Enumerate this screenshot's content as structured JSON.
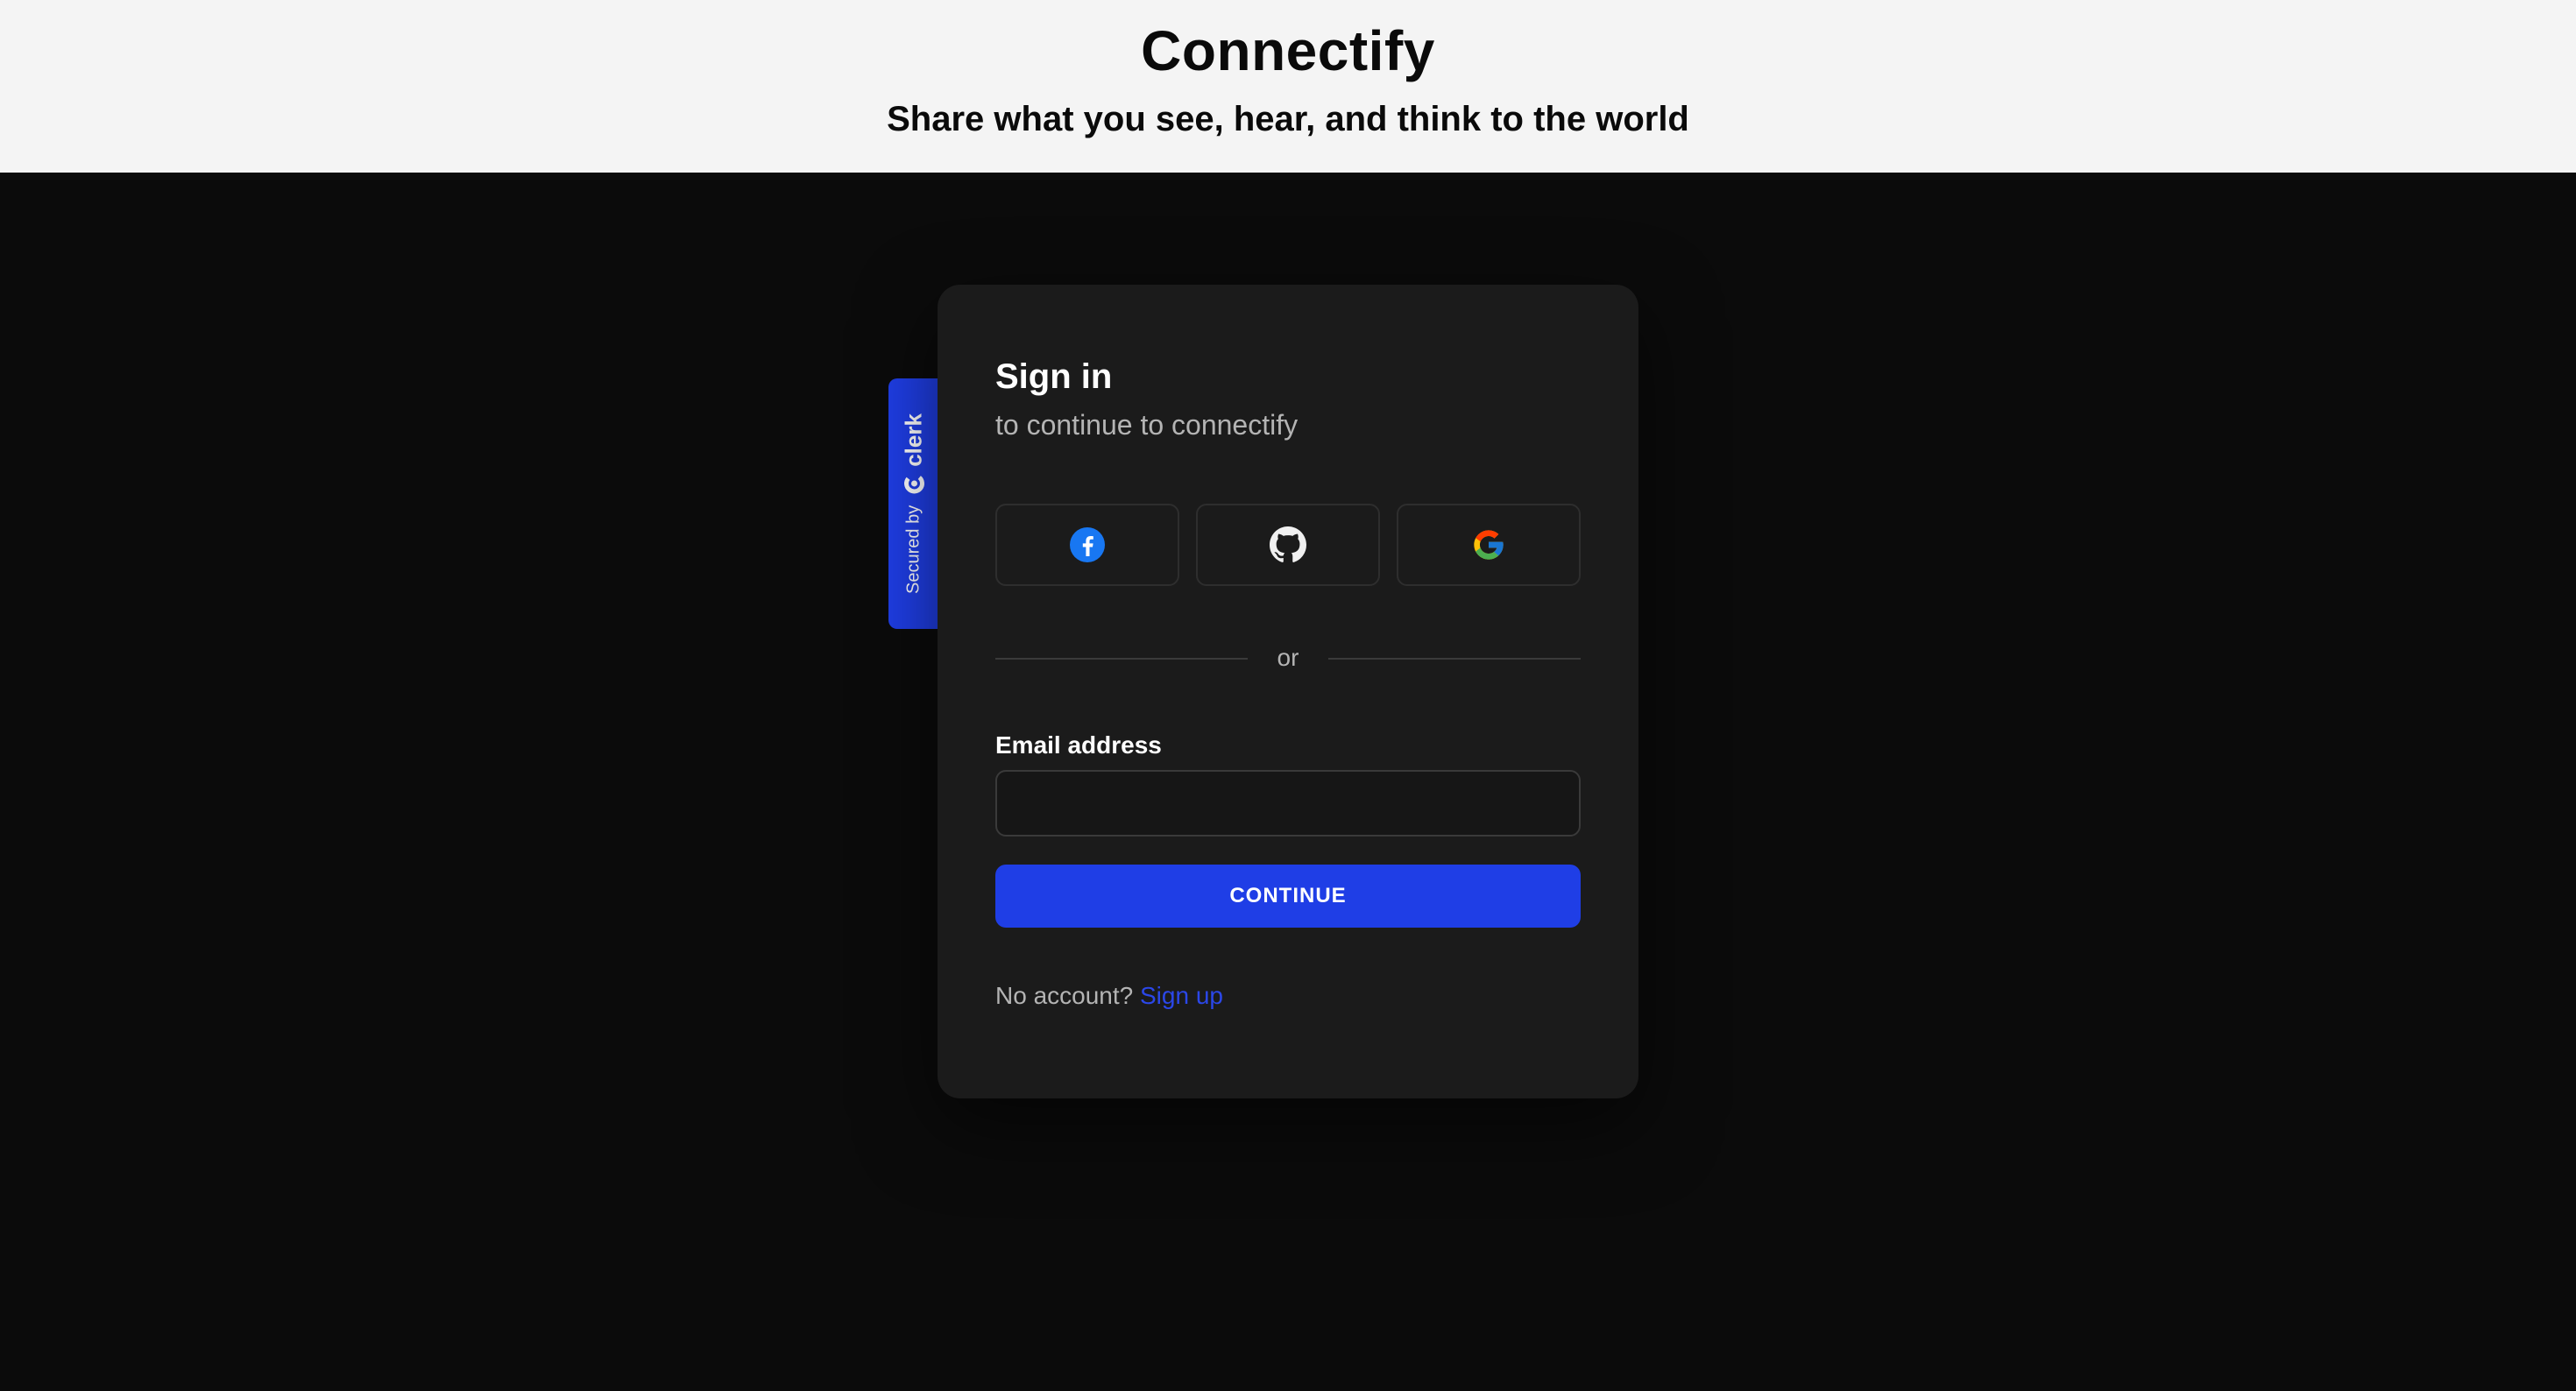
{
  "header": {
    "title": "Connectify",
    "tagline": "Share what you see, hear, and think to the world"
  },
  "badge": {
    "secured_text": "Secured by",
    "brand": "clerk",
    "color": "#1f3ee6"
  },
  "signin": {
    "title": "Sign in",
    "subtitle": "to continue to connectify",
    "social": [
      {
        "provider": "facebook",
        "icon": "facebook-icon"
      },
      {
        "provider": "github",
        "icon": "github-icon"
      },
      {
        "provider": "google",
        "icon": "google-icon"
      }
    ],
    "divider": "or",
    "email_label": "Email address",
    "email_value": "",
    "continue_label": "CONTINUE",
    "no_account_text": "No account?",
    "signup_label": "Sign up"
  },
  "colors": {
    "accent": "#1f3ee6",
    "card_bg": "#1b1b1b",
    "page_bg": "#0b0b0b",
    "header_bg": "#f4f4f4"
  }
}
